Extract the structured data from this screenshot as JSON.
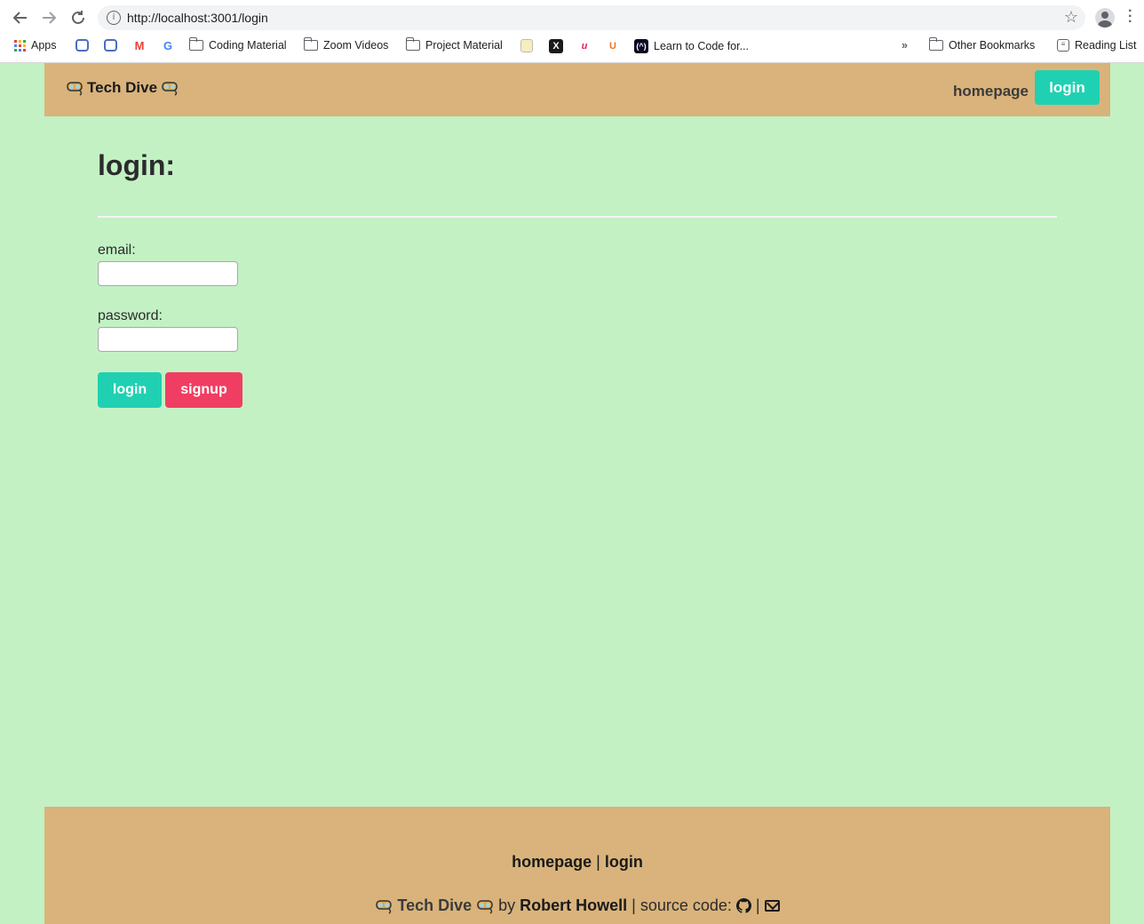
{
  "browser": {
    "url": "http://localhost:3001/login",
    "bookmarks": [
      {
        "label": "Apps",
        "icon": "apps-grid-icon"
      },
      {
        "label": "",
        "icon": "briefcase-icon"
      },
      {
        "label": "",
        "icon": "briefcase-icon"
      },
      {
        "label": "",
        "icon": "gmail-icon"
      },
      {
        "label": "",
        "icon": "google-icon"
      },
      {
        "label": "Coding Material",
        "icon": "folder-icon"
      },
      {
        "label": "Zoom Videos",
        "icon": "folder-icon"
      },
      {
        "label": "Project Material",
        "icon": "folder-icon"
      },
      {
        "label": "",
        "icon": "notes-icon"
      },
      {
        "label": "",
        "icon": "x-icon"
      },
      {
        "label": "",
        "icon": "pen-icon"
      },
      {
        "label": "",
        "icon": "u-icon"
      },
      {
        "label": "Learn to Code for...",
        "icon": "fcc-icon"
      },
      {
        "label": "Other Bookmarks",
        "icon": "folder-icon"
      },
      {
        "label": "Reading List",
        "icon": "reading-list-icon"
      }
    ],
    "overflow_label": "»"
  },
  "header": {
    "brand": "Tech Dive",
    "nav_home": "homepage",
    "nav_login": "login"
  },
  "main": {
    "title": "login:",
    "email_label": "email:",
    "email_value": "",
    "password_label": "password:",
    "password_value": "",
    "login_button": "login",
    "signup_button": "signup"
  },
  "footer": {
    "link_home": "homepage",
    "separator": "|",
    "link_login": "login",
    "brand": "Tech Dive",
    "by": "by",
    "author": "Robert Howell",
    "source_label": "| source code:",
    "separator2": "|"
  },
  "colors": {
    "page_bg": "#c3f1c4",
    "header_bg": "#d9b37b",
    "primary": "#1fd1b2",
    "danger": "#f03e63"
  }
}
